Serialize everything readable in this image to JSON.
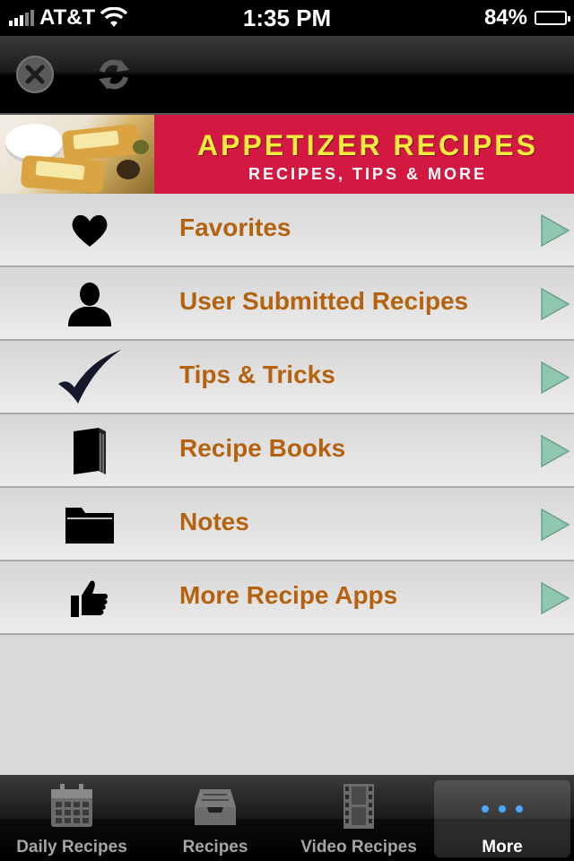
{
  "status_bar": {
    "carrier": "AT&T",
    "time": "1:35 PM",
    "battery": "84%"
  },
  "toolbar": {
    "close_icon": "close-icon",
    "refresh_icon": "refresh-icon"
  },
  "banner": {
    "title": "APPETIZER RECIPES",
    "subtitle": "RECIPES, TIPS & MORE"
  },
  "menu": {
    "items": [
      {
        "label": "Favorites",
        "icon": "heart-icon"
      },
      {
        "label": "User Submitted Recipes",
        "icon": "person-icon"
      },
      {
        "label": "Tips & Tricks",
        "icon": "checkmark-icon"
      },
      {
        "label": "Recipe Books",
        "icon": "book-icon"
      },
      {
        "label": "Notes",
        "icon": "folder-icon"
      },
      {
        "label": "More Recipe Apps",
        "icon": "thumbs-up-icon"
      }
    ]
  },
  "tabs": [
    {
      "label": "Daily Recipes",
      "icon": "calendar-icon"
    },
    {
      "label": "Recipes",
      "icon": "inbox-icon"
    },
    {
      "label": "Video Recipes",
      "icon": "film-icon"
    },
    {
      "label": "More",
      "icon": "more-icon",
      "active": true
    }
  ],
  "colors": {
    "accent_label": "#b5620e",
    "banner_bg": "#d31942",
    "banner_title": "#f3ec3c",
    "arrow": "#8fc7ae"
  }
}
